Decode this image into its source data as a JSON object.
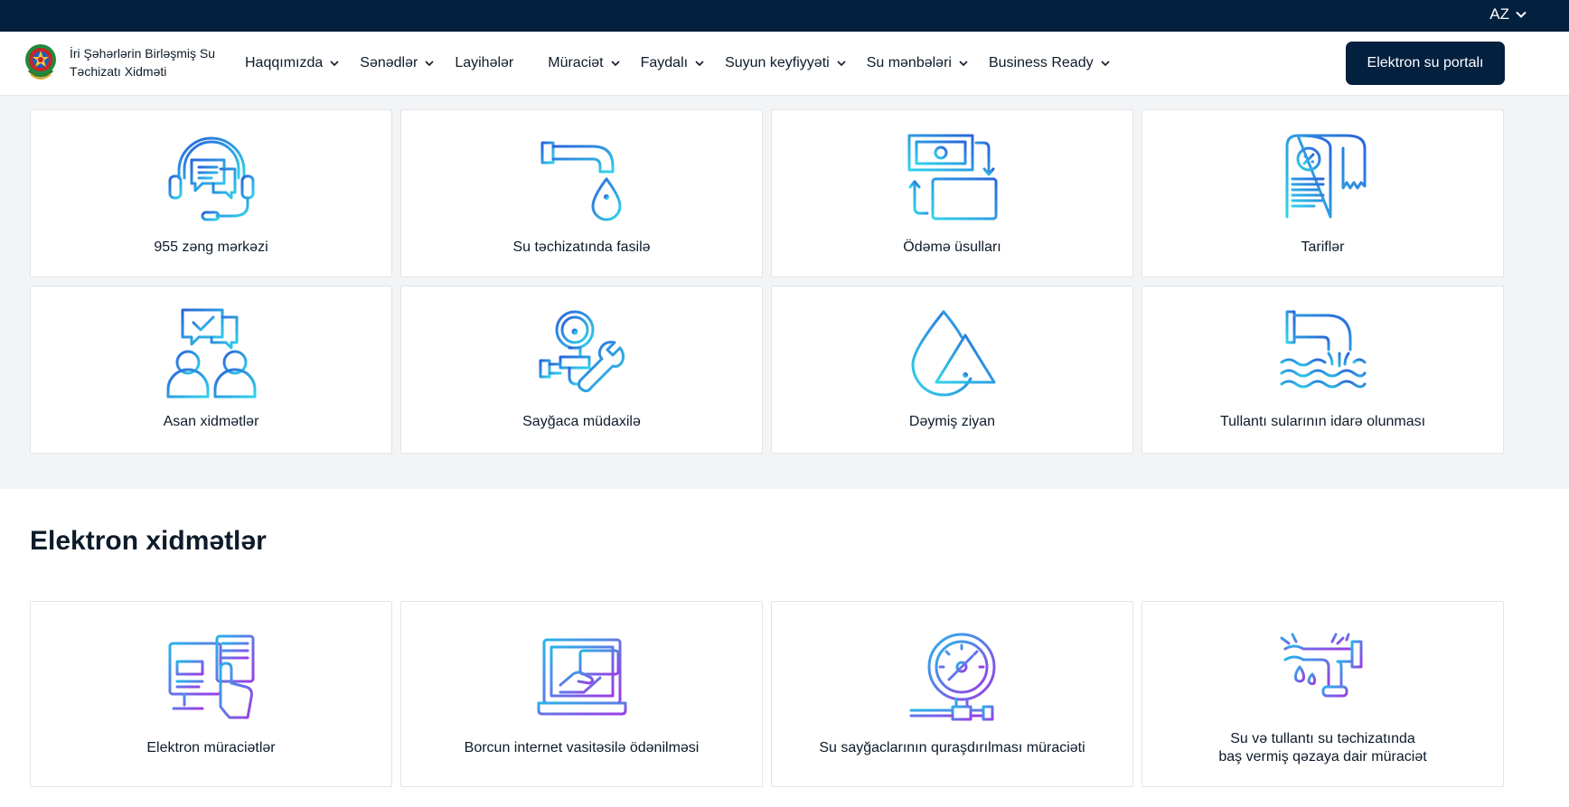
{
  "topbar": {
    "language": "AZ"
  },
  "header": {
    "org_name": "İri Şəhərlərin Birləşmiş Su Təchizatı Xidməti",
    "portal_button": "Elektron su portalı"
  },
  "nav": [
    {
      "label": "Haqqımızda",
      "dropdown": true
    },
    {
      "label": "Sənədlər",
      "dropdown": true
    },
    {
      "label": "Layihələr",
      "dropdown": false
    },
    {
      "label": "Müraciət",
      "dropdown": true
    },
    {
      "label": "Faydalı",
      "dropdown": true
    },
    {
      "label": "Suyun keyfiyyəti",
      "dropdown": true
    },
    {
      "label": "Su mənbələri",
      "dropdown": true
    },
    {
      "label": "Business Ready",
      "dropdown": true
    }
  ],
  "services": [
    {
      "label": "955 zəng mərkəzi",
      "icon": "headset-chat-icon"
    },
    {
      "label": "Su təchizatında fasilə",
      "icon": "faucet-info-icon"
    },
    {
      "label": "Ödəmə üsulları",
      "icon": "payment-methods-icon"
    },
    {
      "label": "Tariflər",
      "icon": "tariff-receipt-icon"
    },
    {
      "label": "Asan xidmətlər",
      "icon": "users-check-icon"
    },
    {
      "label": "Sayğaca müdaxilə",
      "icon": "meter-wrench-icon"
    },
    {
      "label": "Dəymiş ziyan",
      "icon": "drop-warning-icon"
    },
    {
      "label": "Tullantı sularının idarə olunması",
      "icon": "wastewater-pipe-icon"
    }
  ],
  "electronic": {
    "title": "Elektron xidmətlər",
    "items": [
      {
        "label": "Elektron müraciətlər",
        "icon": "online-application-icon"
      },
      {
        "label": "Borcun internet vasitəsilə ödənilməsi",
        "icon": "online-payment-icon"
      },
      {
        "label": "Su sayğaclarının quraşdırılması müraciəti",
        "icon": "water-meter-gauge-icon"
      },
      {
        "label_line1": "Su və tullantı su təchizatında",
        "label_line2": "baş vermiş qəzaya dair müraciət",
        "icon": "broken-pipe-icon"
      }
    ]
  },
  "colors": {
    "navy": "#03203f",
    "cyan": "#2fd0e8",
    "blue": "#2f6fe0",
    "purple": "#8f3fe6"
  }
}
